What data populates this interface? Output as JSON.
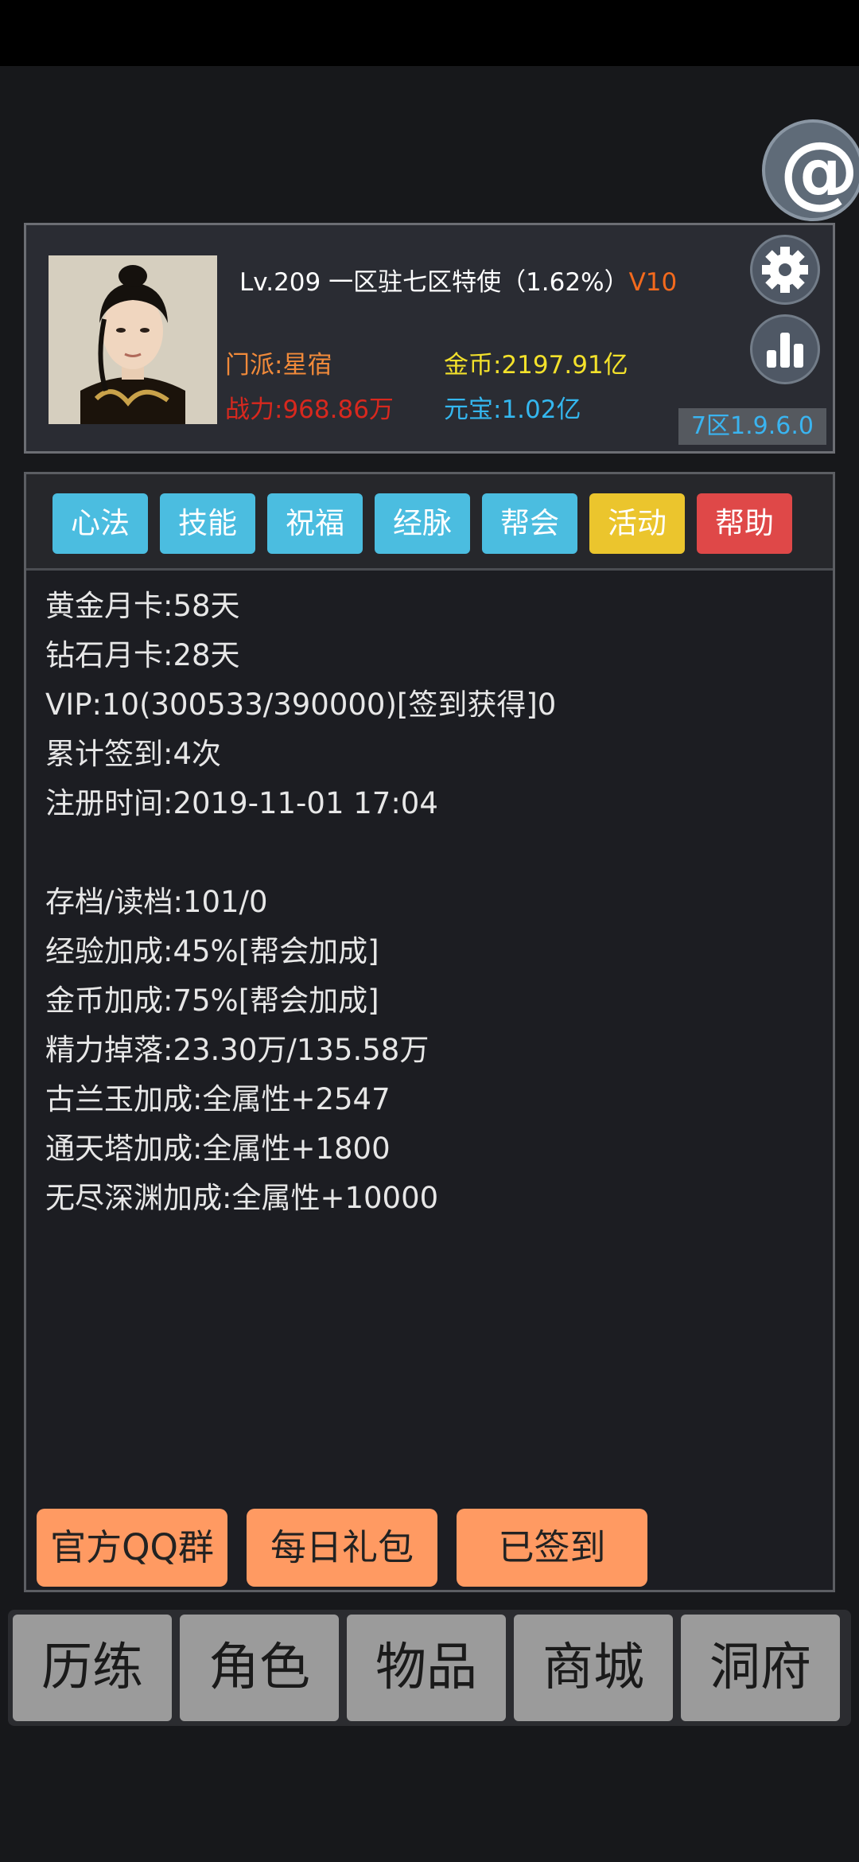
{
  "profile": {
    "line1_main": "Lv.209 一区驻七区特使（1.62%）",
    "line1_vip": "V10",
    "sect": "门派:星宿",
    "gold": "金币:2197.91亿",
    "power": "战力:968.86万",
    "ingot": "元宝:1.02亿",
    "server_version": "7区1.9.6.0"
  },
  "tabs": [
    {
      "label": "心法",
      "color": "#4bbde0"
    },
    {
      "label": "技能",
      "color": "#4bbde0"
    },
    {
      "label": "祝福",
      "color": "#4bbde0"
    },
    {
      "label": "经脉",
      "color": "#4bbde0"
    },
    {
      "label": "帮会",
      "color": "#4bbde0"
    },
    {
      "label": "活动",
      "color": "#ebc52d"
    },
    {
      "label": "帮助",
      "color": "#df4848"
    }
  ],
  "info_lines": [
    "黄金月卡:58天",
    "钻石月卡:28天",
    "VIP:10(300533/390000)[签到获得]0",
    "累计签到:4次",
    "注册时间:2019-11-01 17:04",
    "",
    "存档/读档:101/0",
    "经验加成:45%[帮会加成]",
    "金币加成:75%[帮会加成]",
    "精力掉落:23.30万/135.58万",
    "古兰玉加成:全属性+2547",
    "通天塔加成:全属性+1800",
    "无尽深渊加成:全属性+10000"
  ],
  "actions": {
    "qq_group": "官方QQ群",
    "daily_gift": "每日礼包",
    "signed_in": "已签到"
  },
  "nav": [
    "历练",
    "角色",
    "物品",
    "商城",
    "洞府"
  ],
  "icons": {
    "at": "at-icon",
    "gear": "gear-icon",
    "stats": "bar-chart-icon"
  },
  "colors": {
    "tab_blue": "#4bbde0",
    "tab_yellow": "#ebc52d",
    "tab_red": "#df4848",
    "action_orange": "#ff9a62"
  }
}
